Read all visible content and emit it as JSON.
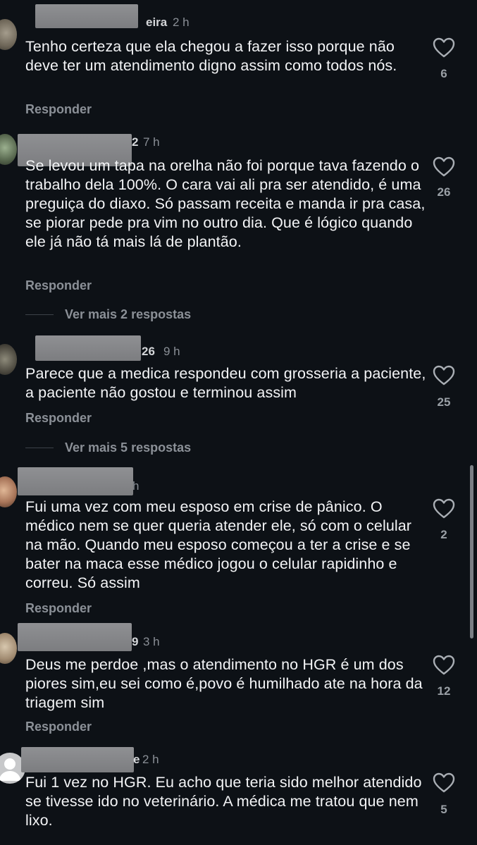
{
  "reply_label": "Responder",
  "comments": [
    {
      "name_visible": "eira",
      "time": "2 h",
      "text": "Tenho certeza que ela chegou a fazer isso porque não deve ter um atendimento digno assim como todos nós.",
      "likes": "6"
    },
    {
      "name_visible": "2",
      "time": "7 h",
      "text": "Se levou um tapa na orelha não foi porque tava fazendo o trabalho dela 100%. O cara vai ali pra ser atendido, é uma preguiça do diaxo. Só passam receita e manda ir pra casa, se piorar pede pra vim no outro dia. Que é lógico quando ele já não tá mais lá de plantão.",
      "likes": "26",
      "more_replies": "Ver mais 2 respostas"
    },
    {
      "name_visible": "26",
      "time": "9 h",
      "text": "Parece que a medica respondeu com grosseria a paciente, a paciente não gostou e terminou assim",
      "likes": "25",
      "more_replies": "Ver mais 5 respostas"
    },
    {
      "name_visible": "",
      "time": "h",
      "text": "Fui uma vez com meu esposo em crise de pânico. O médico nem se quer queria atender ele, só com o celular na mão. Quando meu esposo começou a ter a crise e se bater na maca esse médico jogou o celular rapidinho e correu. Só assim",
      "likes": "2"
    },
    {
      "name_visible": "9",
      "time": "3 h",
      "text": "Deus me perdoe ,mas o atendimento no HGR é um dos piores sim,eu sei como é,povo é humilhado ate na hora da triagem sim",
      "likes": "12"
    },
    {
      "name_visible": "e",
      "time": "2 h",
      "text": "Fui 1 vez no HGR. Eu acho que teria sido melhor atendido se tivesse ido no veterinário. A médica me tratou que nem lixo.",
      "likes": "5"
    }
  ]
}
